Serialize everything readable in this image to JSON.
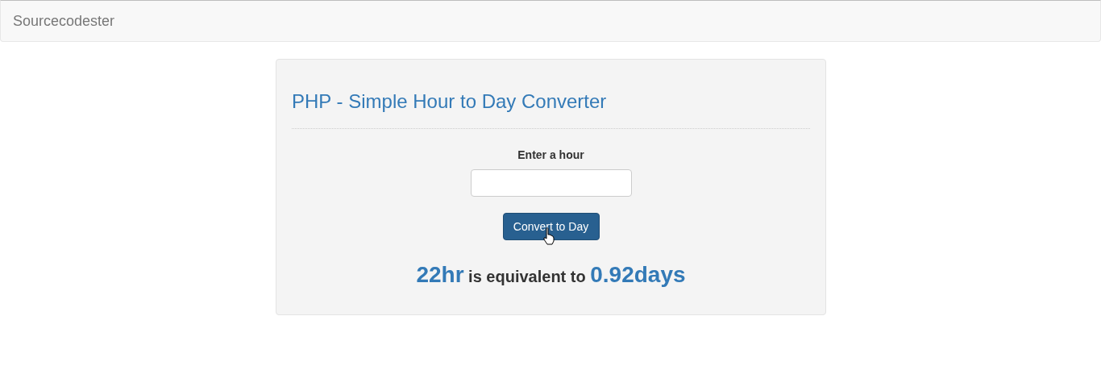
{
  "navbar": {
    "brand": "Sourcecodester"
  },
  "panel": {
    "title": "PHP - Simple Hour to Day Converter",
    "field_label": "Enter a hour",
    "button": "Convert to Day",
    "result": {
      "hours": "22hr",
      "middle": "is equivalent to",
      "days": "0.92days"
    }
  }
}
